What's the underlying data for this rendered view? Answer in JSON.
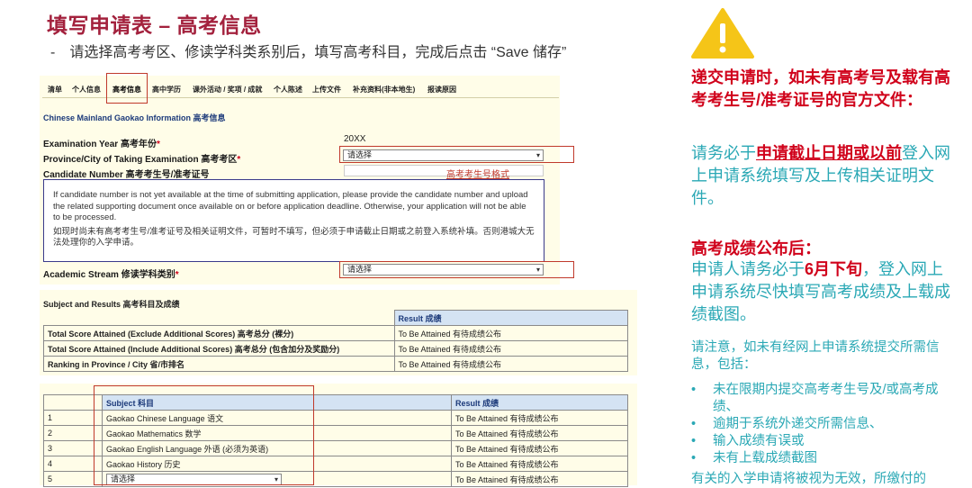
{
  "header": {
    "title": "填写申请表 – 高考信息",
    "dash": "-",
    "instruction": "请选择高考考区、修读学科类系别后，填写高考科目，完成后点击 “Save 储存”"
  },
  "tabs": [
    "清单",
    "个人信息",
    "高考信息",
    "高中学历",
    "课外活动 / 奖项 / 成就",
    "个人陈述",
    "上传文件",
    "补充资料(非本地生)",
    "报读原因"
  ],
  "active_tab": "高考信息",
  "form": {
    "section_title": "Chinese Mainland Gaokao Information 高考信息",
    "exam_year_label": "Examination Year 高考年份",
    "exam_year_value": "20XX",
    "province_label": "Province/City of Taking Examination 高考考区",
    "province_select": "请选择",
    "candidate_label": "Candidate Number 高考考生号/准考证号",
    "candidate_format_link": "高考考生号格式",
    "required_mark": "*",
    "note_en": "If candidate number is not yet available at the time of submitting application, please provide the candidate number and upload the related supporting document once available on or before application deadline. Otherwise, your application will not be able to be processed.",
    "note_cn": "如现时尚未有高考考生号/准考证号及相关证明文件，可暂时不填写，但必须于申请截止日期或之前登入系统补填。否则港城大无法处理你的入学申请。",
    "stream_label": "Academic Stream 修读学科类别",
    "stream_select": "请选择"
  },
  "results": {
    "section_title": "Subject and Results 高考科目及成绩",
    "result_header": "Result 成绩",
    "rows": [
      {
        "label": "Total Score Attained (Exclude Additional Scores) 高考总分 (裸分)",
        "value": "To Be Attained 有待成绩公布"
      },
      {
        "label": "Total Score Attained (Include Additional Scores) 高考总分 (包含加分及奖励分)",
        "value": "To Be Attained 有待成绩公布"
      },
      {
        "label": "Ranking in Province / City 省/市排名",
        "value": "To Be Attained 有待成绩公布"
      }
    ]
  },
  "subjects": {
    "subject_header": "Subject 科目",
    "result_header": "Result 成绩",
    "rows": [
      {
        "no": "1",
        "subject": "Gaokao Chinese Language 语文",
        "value": "To Be Attained 有待成绩公布"
      },
      {
        "no": "2",
        "subject": "Gaokao Mathematics 数学",
        "value": "To Be Attained 有待成绩公布"
      },
      {
        "no": "3",
        "subject": "Gaokao English Language 外语 (必须为英语)",
        "value": "To Be Attained 有待成绩公布"
      },
      {
        "no": "4",
        "subject": "Gaokao History 历史",
        "value": "To Be Attained 有待成绩公布"
      },
      {
        "no": "5",
        "subject": "请选择",
        "value": "To Be Attained 有待成绩公布"
      }
    ]
  },
  "panel": {
    "warning_icon": "warning-icon",
    "warning_color": "#f5c518",
    "warn_title": "递交申请时，如未有高考号及载有高考考生号/准考证号的官方文件：",
    "blue1_pre": "请务必于",
    "blue1_emph": "申请截止日期或以前",
    "blue1_post": "登入网上申请系统填写及上传相关证明文件。",
    "gk_title": "高考成绩公布后：",
    "blue2_pre": "申请人请务必于",
    "blue2_emph": "6月下旬",
    "blue2_post": "，登入网上申请系统尽快填写高考成绩及上载成绩截图。",
    "note_intro": "请注意，如未有经网上申请系统提交所需信息，包括：",
    "bullets": [
      "未在限期内提交高考考生号及/或高考成绩、",
      "逾期于系统外递交所需信息、",
      "输入成绩有误或",
      "未有上载成绩截图"
    ],
    "footer_note": "有关的入学申请将被视为无效，所缴付的"
  },
  "colors": {
    "title": "#a3213d",
    "alert_red": "#d0021b",
    "teal": "#2aa8b5",
    "table_header": "#d4e3f3",
    "form_bg": "#fffde8"
  }
}
